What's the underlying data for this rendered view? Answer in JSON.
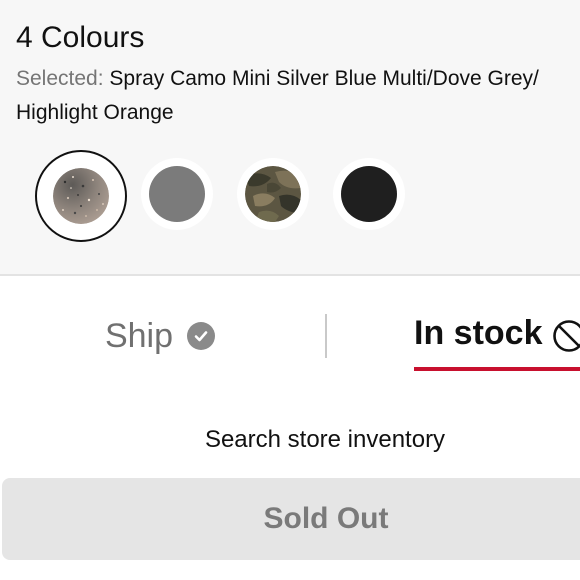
{
  "colours": {
    "count_label": "4 Colours",
    "selected_label": "Selected:",
    "selected_value_line1": "Spray Camo Mini Silver Blue Multi/Dove Grey/",
    "selected_value_line2": "Highlight Orange",
    "swatches": [
      {
        "name": "Spray Camo Mini Silver Blue Multi/Dove Grey/Highlight Orange",
        "color": "#8a8079",
        "selected": true
      },
      {
        "name": "grey",
        "color": "#7b7b7b",
        "selected": false
      },
      {
        "name": "camo",
        "color": "#5a5440",
        "selected": false
      },
      {
        "name": "black",
        "color": "#1f1f1f",
        "selected": false
      }
    ]
  },
  "delivery": {
    "ship_label": "Ship",
    "in_stock_label": "In stock",
    "active_tab": "In stock",
    "accent_color": "#c8102e"
  },
  "store": {
    "search_label": "Search store inventory"
  },
  "purchase": {
    "sold_out_label": "Sold Out"
  }
}
